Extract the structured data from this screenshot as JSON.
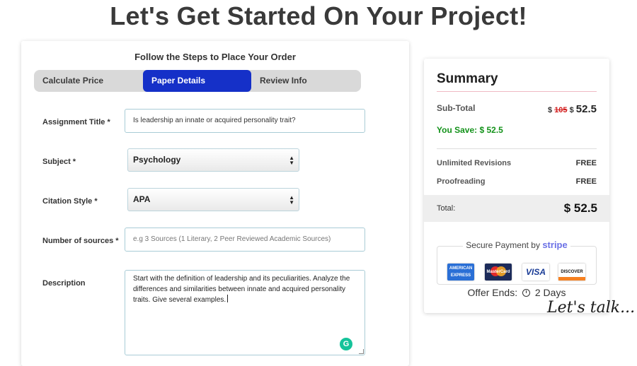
{
  "page_title": "Let's Get Started On Your Project!",
  "order_form": {
    "heading": "Follow the Steps to Place Your Order",
    "steps": [
      {
        "label": "Calculate Price",
        "active": false
      },
      {
        "label": "Paper Details",
        "active": true
      },
      {
        "label": "Review Info",
        "active": false
      }
    ],
    "fields": {
      "assignment_title": {
        "label": "Assignment Title *",
        "value": "Is leadership an innate or acquired personality trait?"
      },
      "subject": {
        "label": "Subject *",
        "value": "Psychology"
      },
      "citation_style": {
        "label": "Citation Style *",
        "value": "APA"
      },
      "sources": {
        "label": "Number of sources *",
        "placeholder": "e.g 3 Sources (1 Literary, 2 Peer Reviewed Academic Sources)"
      },
      "description": {
        "label": "Description",
        "value": "Start with the definition of leadership and its peculiarities. Analyze the differences and similarities between innate and acquired personality traits. Give several examples."
      }
    },
    "icons": {
      "grammarly": "grammarly-icon",
      "select_arrow": "updown-arrows-icon"
    },
    "grammarly_glyph": "G"
  },
  "summary": {
    "title": "Summary",
    "subtotal_label": "Sub-Total",
    "old_price_symbol": "$",
    "old_price": "105",
    "new_price_symbol": "$",
    "new_price": "52.5",
    "you_save": "You Save: $ 52.5",
    "perks": [
      {
        "label": "Unlimited Revisions",
        "value": "FREE"
      },
      {
        "label": "Proofreading",
        "value": "FREE"
      }
    ],
    "total_label": "Total:",
    "total_value": "$ 52.5",
    "secure_payment": "Secure Payment by",
    "payment_brand": "stripe",
    "cards": [
      "AMERICAN EXPRESS",
      "MasterCard",
      "VISA",
      "DISCOVER"
    ],
    "offer_prefix": "Offer Ends:",
    "offer_value": "2 Days"
  },
  "lets_talk": "Let's talk...",
  "colors": {
    "active_step": "#1530c8",
    "save_green": "#13921a",
    "strike_red": "#d21c1c",
    "stripe": "#6b71e6"
  }
}
